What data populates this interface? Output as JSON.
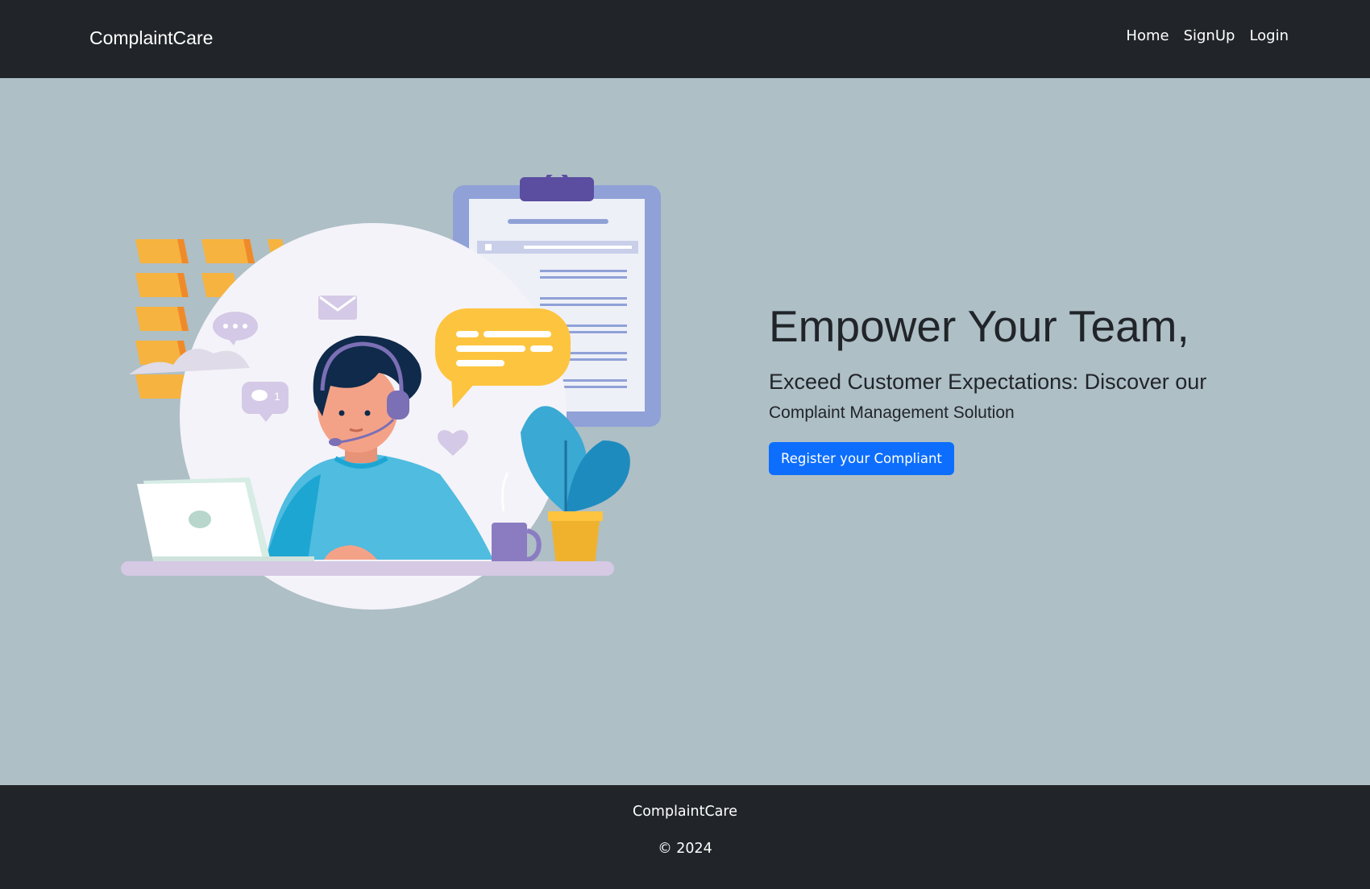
{
  "navbar": {
    "brand": "ComplaintCare",
    "links": [
      {
        "label": "Home"
      },
      {
        "label": "SignUp"
      },
      {
        "label": "Login"
      }
    ]
  },
  "hero": {
    "title": "Empower Your Team,",
    "subtitle_line1": "Exceed Customer Expectations: Discover our",
    "subtitle_line2": "Complaint Management Solution",
    "cta_label": "Register your Compliant",
    "illustration": "customer-support-agent-illustration"
  },
  "footer": {
    "brand": "ComplaintCare",
    "copyright": "© 2024"
  },
  "colors": {
    "navbar_bg": "#212529",
    "hero_bg": "#aebfc6",
    "primary": "#0d6efd"
  }
}
